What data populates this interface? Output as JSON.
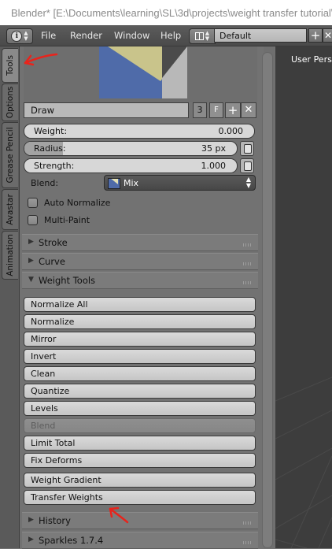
{
  "window": {
    "title": "Blender* [E:\\Documents\\learning\\SL\\3d\\projects\\weight transfer tutorial\\w"
  },
  "menubar": {
    "items": [
      "File",
      "Render",
      "Window",
      "Help"
    ],
    "layout": "Default",
    "info_icon": "info-icon"
  },
  "tabs": [
    "Tools",
    "Options",
    "Grease Pencil",
    "Avastar",
    "Animation"
  ],
  "brush": {
    "name": "Draw",
    "users": "3",
    "fake_user": "F"
  },
  "sliders": {
    "weight": {
      "label": "Weight:",
      "value": "0.000",
      "fraction": 0.0
    },
    "radius": {
      "label": "Radius:",
      "value": "35 px",
      "fraction": 0.18
    },
    "strength": {
      "label": "Strength:",
      "value": "1.000",
      "fraction": 0.0
    }
  },
  "blend": {
    "label": "Blend:",
    "value": "Mix"
  },
  "checkboxes": {
    "auto_normalize": "Auto Normalize",
    "multi_paint": "Multi-Paint"
  },
  "panels": {
    "stroke": "Stroke",
    "curve": "Curve",
    "weight_tools": "Weight Tools",
    "history": "History",
    "sparkles": "Sparkles 1.7.4"
  },
  "weight_tools": {
    "normalize_all": "Normalize All",
    "normalize": "Normalize",
    "mirror": "Mirror",
    "invert": "Invert",
    "clean": "Clean",
    "quantize": "Quantize",
    "levels": "Levels",
    "blend": "Blend",
    "limit_total": "Limit Total",
    "fix_deforms": "Fix Deforms",
    "weight_gradient": "Weight Gradient",
    "transfer_weights": "Transfer Weights"
  },
  "viewport": {
    "label": "User Persp"
  },
  "colors": {
    "annotation": "#e8241c",
    "viewport_bg": "#3d3d3d"
  }
}
